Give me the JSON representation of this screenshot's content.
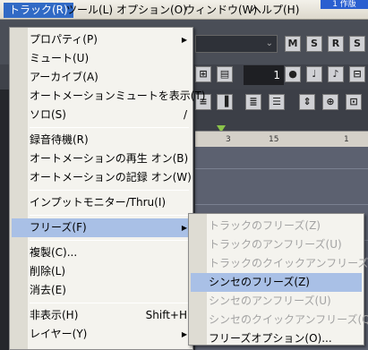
{
  "menubar": {
    "items": [
      "トラック(R)",
      "ツール(L)",
      "オプション(O)",
      "ウィンドウ(W)",
      "ヘルプ(H)"
    ],
    "title_fragment": "1 作版"
  },
  "background": {
    "buttons": [
      "M",
      "S",
      "R",
      "S"
    ],
    "number_value": "1",
    "ruler_ticks": [
      "3",
      "15",
      "1"
    ]
  },
  "track_menu": {
    "items": [
      {
        "label": "プロパティ(P)",
        "submenu": true
      },
      {
        "label": "ミュート(U)"
      },
      {
        "label": "アーカイブ(A)"
      },
      {
        "label": "オートメーションミュートを表示(T)"
      },
      {
        "label": "ソロ(S)",
        "shortcut": "/"
      },
      {
        "label": "録音待機(R)"
      },
      {
        "label": "オートメーションの再生 オン(B)"
      },
      {
        "label": "オートメーションの記録 オン(W)"
      },
      {
        "label": "インプットモニター/Thru(I)"
      },
      {
        "label": "フリーズ(F)",
        "submenu": true
      },
      {
        "label": "複製(C)..."
      },
      {
        "label": "削除(L)"
      },
      {
        "label": "消去(E)"
      },
      {
        "label": "非表示(H)",
        "shortcut": "Shift+H"
      },
      {
        "label": "レイヤー(Y)",
        "submenu": true
      }
    ],
    "submenu_arrow": "▶"
  },
  "freeze_submenu": {
    "items": [
      {
        "label": "トラックのフリーズ(Z)",
        "enabled": false
      },
      {
        "label": "トラックのアンフリーズ(U)",
        "enabled": false
      },
      {
        "label": "トラックのクイックアンフリーズ(Q)",
        "enabled": false
      },
      {
        "label": "シンセのフリーズ(Z)",
        "enabled": true
      },
      {
        "label": "シンセのアンフリーズ(U)",
        "enabled": false
      },
      {
        "label": "シンセのクイックアンフリーズ(Q)",
        "enabled": false
      },
      {
        "label": "フリーズオプション(O)...",
        "enabled": true
      }
    ]
  },
  "colors": {
    "menu_highlight": "#a9c0e6",
    "menubar_active": "#316ac5",
    "disabled_text": "#a3a3a3"
  }
}
